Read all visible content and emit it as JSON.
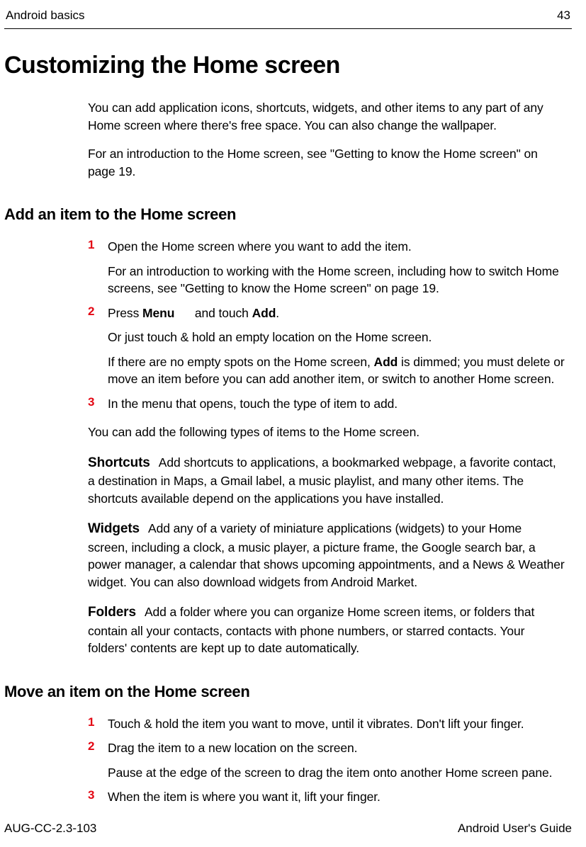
{
  "header": {
    "section": "Android basics",
    "page": "43"
  },
  "title": "Customizing the Home screen",
  "intro": {
    "p1": "You can add application icons, shortcuts, widgets, and other items to any part of any Home screen where there's free space. You can also change the wallpaper.",
    "p2": "For an introduction to the Home screen, see \"Getting to know the Home screen\" on page 19."
  },
  "section1": {
    "heading": "Add an item to the Home screen",
    "step1": {
      "num": "1",
      "text": "Open the Home screen where you want to add the item.",
      "sub": "For an introduction to working with the Home screen, including how to switch Home screens, see \"Getting to know the Home screen\" on page 19."
    },
    "step2": {
      "num": "2",
      "text_prefix": "Press ",
      "menu_bold": "Menu",
      "text_mid": " and touch ",
      "add_bold": "Add",
      "text_suffix": ".",
      "sub1": "Or just touch & hold an empty location on the Home screen.",
      "sub2_prefix": "If there are no empty spots on the Home screen, ",
      "sub2_add": "Add",
      "sub2_suffix": " is dimmed; you must delete or move an item before you can add another item, or switch to another Home screen."
    },
    "step3": {
      "num": "3",
      "text": "In the menu that opens, touch the type of item to add."
    },
    "after_steps": "You can add the following types of items to the Home screen.",
    "shortcuts": {
      "label": "Shortcuts",
      "text": "Add shortcuts to applications, a bookmarked webpage, a favorite contact, a destination in Maps, a Gmail label, a music playlist, and many other items. The shortcuts available depend on the applications you have installed."
    },
    "widgets": {
      "label": "Widgets",
      "text": "Add any of a variety of miniature applications (widgets) to your Home screen, including a clock, a music player, a picture frame, the Google search bar, a power manager, a calendar that shows upcoming appointments, and a News & Weather widget. You can also download widgets from Android Market."
    },
    "folders": {
      "label": "Folders",
      "text": "Add a folder where you can organize Home screen items, or folders that contain all your contacts, contacts with phone numbers, or starred contacts. Your folders' contents are kept up to date automatically."
    }
  },
  "section2": {
    "heading": "Move an item on the Home screen",
    "step1": {
      "num": "1",
      "text": "Touch & hold the item you want to move, until it vibrates. Don't lift your finger."
    },
    "step2": {
      "num": "2",
      "text": "Drag the item to a new location on the screen.",
      "sub": "Pause at the edge of the screen to drag the item onto another Home screen pane."
    },
    "step3": {
      "num": "3",
      "text": "When the item is where you want it, lift your finger."
    }
  },
  "footer": {
    "left": "AUG-CC-2.3-103",
    "right": "Android User's Guide"
  }
}
